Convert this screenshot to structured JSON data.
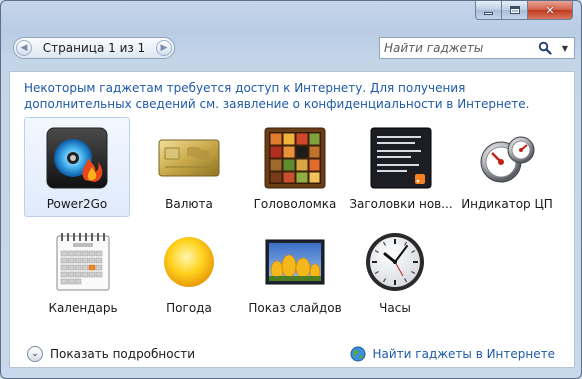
{
  "window": {
    "caption_buttons": [
      {
        "name": "minimize",
        "icon": "minimize-icon"
      },
      {
        "name": "maximize",
        "icon": "maximize-icon"
      },
      {
        "name": "close",
        "icon": "close-icon",
        "glyph": "✕"
      }
    ]
  },
  "pager": {
    "text": "Страница 1 из 1",
    "prev_glyph": "◀",
    "next_glyph": "▶"
  },
  "search": {
    "placeholder": "Найти гаджеты",
    "dropdown_glyph": "▼"
  },
  "notice": "Некоторым гаджетам требуется доступ к Интернету. Для получения дополнительных сведений см. заявление о конфиденциальности в Интернете.",
  "gadgets": [
    {
      "label": "Power2Go",
      "icon": "power2go-icon",
      "selected": true
    },
    {
      "label": "Валюта",
      "icon": "currency-card-icon",
      "selected": false
    },
    {
      "label": "Головоломка",
      "icon": "puzzle-icon",
      "selected": false
    },
    {
      "label": "Заголовки нов...",
      "icon": "news-headlines-icon",
      "selected": false
    },
    {
      "label": "Индикатор ЦП",
      "icon": "cpu-meter-icon",
      "selected": false
    },
    {
      "label": "Календарь",
      "icon": "calendar-icon",
      "selected": false
    },
    {
      "label": "Погода",
      "icon": "weather-sun-icon",
      "selected": false
    },
    {
      "label": "Показ слайдов",
      "icon": "slideshow-icon",
      "selected": false
    },
    {
      "label": "Часы",
      "icon": "clock-icon",
      "selected": false
    }
  ],
  "footer": {
    "details_label": "Показать подробности",
    "online_label": "Найти гаджеты в Интернете"
  },
  "colors": {
    "link": "#1e5aa8",
    "frame": "#c6d6ea",
    "selection": "#dfeafb"
  }
}
